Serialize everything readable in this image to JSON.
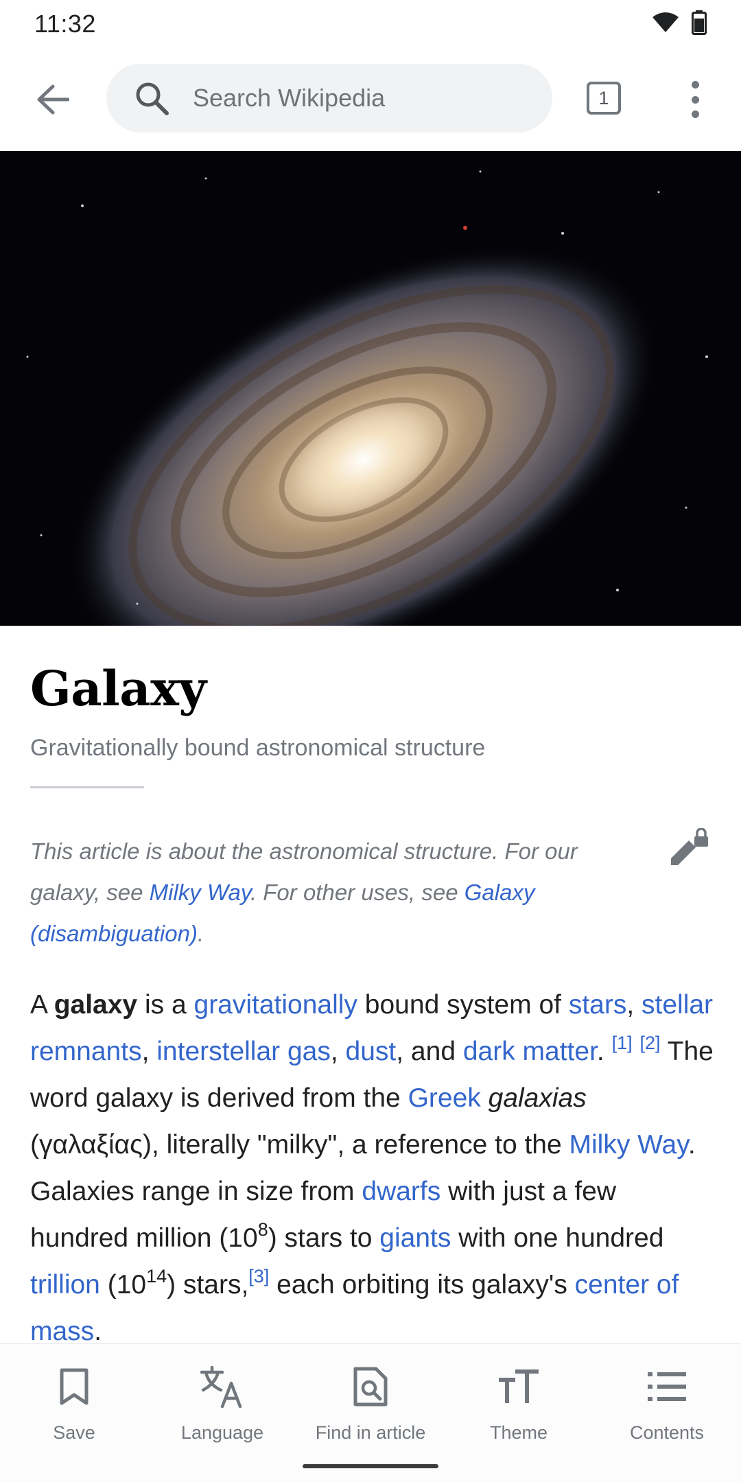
{
  "status_bar": {
    "time": "11:32",
    "icons": [
      "wifi-icon",
      "battery-icon"
    ]
  },
  "app_bar": {
    "search_placeholder": "Search Wikipedia",
    "tab_count": "1",
    "icons": [
      "back-arrow-icon",
      "search-icon",
      "tabs-icon",
      "more-vert-icon"
    ]
  },
  "article": {
    "title": "Galaxy",
    "subtitle": "Gravitationally bound astronomical structure",
    "hatnote": {
      "t1": "This article is about the astronomical structure. For our galaxy, see ",
      "link1": "Milky Way",
      "t2": ". For other uses, see ",
      "link2": "Galaxy (disambiguation)",
      "t3": "."
    },
    "lead": {
      "w1": "A ",
      "bold": "galaxy",
      "w2": " is a ",
      "l_grav": "gravitationally",
      "w3": " bound system of ",
      "l_stars": "stars",
      "w4": ", ",
      "l_remnants": "stellar remnants",
      "w5": ", ",
      "l_gas": "interstellar gas",
      "w6": ", ",
      "l_dust": "dust",
      "w7": ", and ",
      "l_dark": "dark matter",
      "w8": ". ",
      "ref1": "[1]",
      "ref2": "[2]",
      "w9": " The word galaxy is derived from the ",
      "l_greek": "Greek",
      "w10": " ",
      "italic": "galaxias",
      "w11": " (γαλαξίας), literally \"milky\", a reference to the ",
      "l_milky": "Milky Way",
      "w12": ". Galaxies range in size from ",
      "l_dwarfs": "dwarfs",
      "w13": " with just a few hundred million (10",
      "exp1": "8",
      "w14": ") stars to ",
      "l_giants": "giants",
      "w15": " with one hundred ",
      "l_trillion": "trillion",
      "w16": " (10",
      "exp2": "14",
      "w17": ") stars,",
      "ref3": "[3]",
      "w18": " each orbiting its galaxy's ",
      "l_center": "center of mass",
      "w19": "."
    }
  },
  "toolbar": {
    "items": [
      {
        "label": "Save",
        "icon": "bookmark-icon"
      },
      {
        "label": "Language",
        "icon": "translate-icon"
      },
      {
        "label": "Find in article",
        "icon": "find-in-page-icon"
      },
      {
        "label": "Theme",
        "icon": "text-size-icon"
      },
      {
        "label": "Contents",
        "icon": "list-icon"
      }
    ]
  },
  "colors": {
    "link": "#3366cc",
    "text": "#202122",
    "muted": "#72777d",
    "search_bg": "#f1f2f4"
  }
}
